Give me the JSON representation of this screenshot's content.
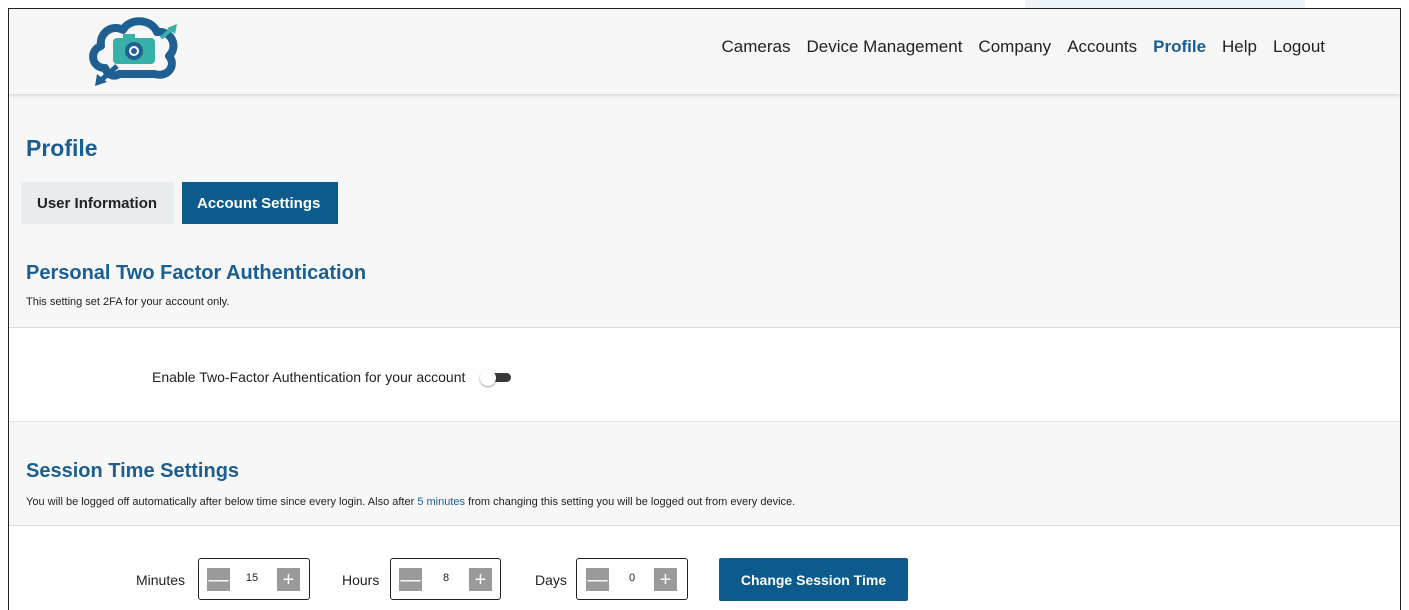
{
  "nav": {
    "items": [
      {
        "label": "Cameras",
        "active": false
      },
      {
        "label": "Device Management",
        "active": false
      },
      {
        "label": "Company",
        "active": false
      },
      {
        "label": "Accounts",
        "active": false
      },
      {
        "label": "Profile",
        "active": true
      },
      {
        "label": "Help",
        "active": false
      },
      {
        "label": "Logout",
        "active": false
      }
    ]
  },
  "page": {
    "title": "Profile"
  },
  "tabs": [
    {
      "label": "User Information",
      "active": false
    },
    {
      "label": "Account Settings",
      "active": true
    }
  ],
  "twofa": {
    "heading": "Personal Two Factor Authentication",
    "description": "This setting set 2FA for your account only.",
    "toggle_label": "Enable Two-Factor Authentication for your account",
    "enabled": false
  },
  "session": {
    "heading": "Session Time Settings",
    "desc_before": "You will be logged off automatically after below time since every login. Also after ",
    "desc_link": "5 minutes",
    "desc_after": " from changing this setting you will be logged out from every device.",
    "minutes_label": "Minutes",
    "minutes_value": "15",
    "hours_label": "Hours",
    "hours_value": "8",
    "days_label": "Days",
    "days_value": "0",
    "minus_glyph": "—",
    "plus_glyph": "+",
    "button_label": "Change Session Time"
  },
  "colors": {
    "accent": "#1a5e92",
    "button": "#0d5a8c",
    "logo_primary": "#1f5f91",
    "logo_secondary": "#36b0a8"
  }
}
